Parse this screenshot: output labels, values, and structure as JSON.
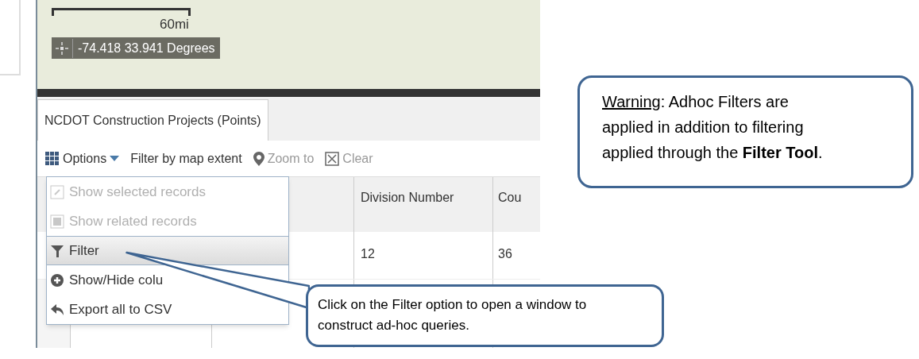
{
  "map": {
    "scale_label": "60mi",
    "coordinates": "-74.418 33.941 Degrees"
  },
  "tabs": [
    {
      "label": "NCDOT Construction Projects (Points)",
      "selected": true
    }
  ],
  "toolbar": [
    {
      "kind": "menu",
      "label": "Options"
    },
    {
      "kind": "text",
      "label": "Filter by map extent"
    },
    {
      "kind": "zoom",
      "label": "Zoom to"
    },
    {
      "kind": "clear",
      "label": "Clear"
    }
  ],
  "table": {
    "columns": [
      {
        "label": "Division Number"
      },
      {
        "label": "Cou"
      }
    ],
    "rows": [
      [
        "12",
        "36"
      ]
    ]
  },
  "options_menu": [
    {
      "kind": "pin",
      "label": "Show selected records",
      "disabled": true,
      "selected": false
    },
    {
      "kind": "square",
      "label": "Show related records",
      "disabled": true,
      "selected": false
    },
    {
      "kind": "filter",
      "label": "Filter",
      "disabled": false,
      "selected": true
    },
    {
      "kind": "plus",
      "label": "Show/Hide colu",
      "disabled": false,
      "selected": false
    },
    {
      "kind": "export",
      "label": "Export all to CSV",
      "disabled": false,
      "selected": false
    }
  ],
  "callouts": [
    {
      "kind": "warning",
      "heading": "Warning",
      "text": ":  Adhoc Filters are applied in addition to filtering applied through the **Filter Tool**."
    },
    {
      "kind": "tip",
      "text": "Click on the Filter option to open a window to construct ad-hoc queries."
    }
  ]
}
